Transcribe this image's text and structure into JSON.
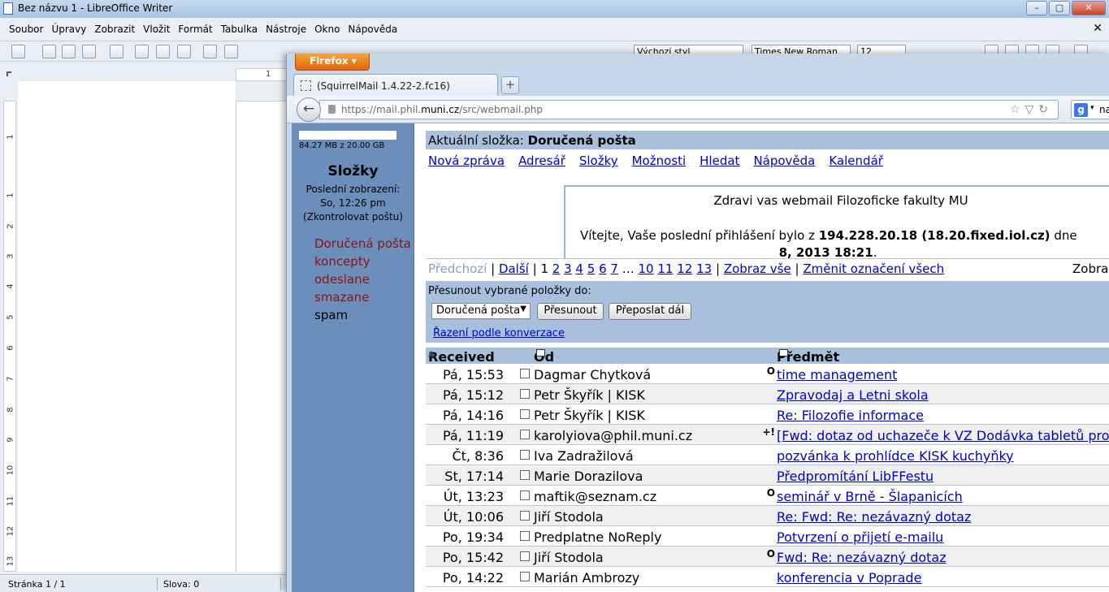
{
  "writer": {
    "title": "Bez názvu 1 - LibreOffice Writer",
    "menu": [
      "Soubor",
      "Úpravy",
      "Zobrazit",
      "Vložit",
      "Formát",
      "Tabulka",
      "Nástroje",
      "Okno",
      "Nápověda"
    ],
    "toolbar": {
      "style": "Výchozí styl",
      "font": "Times New Roman",
      "size": "12"
    },
    "ruler_top_label": "1",
    "ruler_left": [
      "1",
      "1",
      "2",
      "3",
      "4",
      "5",
      "6",
      "7",
      "8",
      "9",
      "10",
      "11",
      "12",
      "13"
    ],
    "status": {
      "page": "Stránka 1 / 1",
      "words": "Slova: 0"
    }
  },
  "firefox": {
    "button_label": "Firefox",
    "tab_label": "(SquirrelMail 1.4.22-2.fc16)",
    "newtab_label": "+",
    "url_prefix": "https://mail.phil.",
    "url_domain": "muni.cz",
    "url_path": "/src/webmail.php",
    "search_text": "na"
  },
  "sidebar": {
    "quota": "84.27 MB z 20.00 GB",
    "title": "Složky",
    "last_label": "Poslední zobrazení:",
    "last_time": "So, 12:26 pm",
    "check_open": "(",
    "check_link": "Zkontrolovat poštu",
    "check_close": ")",
    "folders": [
      "Doručená pošta",
      "koncepty",
      "odeslane",
      "smazane",
      "spam"
    ]
  },
  "main": {
    "current_label": "Aktuální složka:",
    "current_folder": "Doručená pošta",
    "nav": [
      "Nová zpráva",
      "Adresář",
      "Složky",
      "Možnosti",
      "Hledat",
      "Nápověda",
      "Kalendář"
    ],
    "motd": {
      "line1": "Zdravi vas webmail Filozoficke fakulty MU",
      "line2_pre": "Vítejte, Vaše poslední přihlášení bylo z ",
      "line2_bold": "194.228.20.18 (18.20.fixed.iol.cz)",
      "line2_post": " dne",
      "line3_bold": "8, 2013 18:21",
      "line3_post": "."
    },
    "paging": {
      "prev": "Předchozí",
      "next": "Další",
      "current": "1",
      "pages": [
        "2",
        "3",
        "4",
        "5",
        "6",
        "7"
      ],
      "ellipsis": "…",
      "pages_end": [
        "10",
        "11",
        "12",
        "13"
      ],
      "show_all": "Zobraz vše",
      "toggle_all": "Změnit označení všech",
      "right": "Zobra"
    },
    "move": {
      "label": "Přesunout vybrané položky do:",
      "target": "Doručená pošta",
      "move_btn": "Přesunout",
      "forward_btn": "Přeposlat dál",
      "thread_link": "Řazení podle konverzace"
    },
    "table": {
      "col_received": "Received",
      "col_from": "Od",
      "col_subject": "Předmět",
      "rows": [
        {
          "date": "Pá, 15:53",
          "from": "Dagmar Chytková",
          "flag": "O",
          "subject": "time management"
        },
        {
          "date": "Pá, 15:12",
          "from": "Petr Škyřík | KISK",
          "flag": "",
          "subject": "Zpravodaj a Letni skola"
        },
        {
          "date": "Pá, 14:16",
          "from": "Petr Škyřík | KISK",
          "flag": "",
          "subject": "Re: Filozofie informace"
        },
        {
          "date": "Pá, 11:19",
          "from": "karolyiova@phil.muni.cz",
          "flag": "+!",
          "subject": "[Fwd: dotaz od uchazeče k VZ Dodávka tabletů pro"
        },
        {
          "date": "Čt, 8:36",
          "from": "Iva Zadražilová",
          "flag": "",
          "subject": "pozvánka k prohlídce KISK kuchyňky"
        },
        {
          "date": "St, 17:14",
          "from": "Marie Dorazilova",
          "flag": "",
          "subject": "Předpromítání LibFFestu"
        },
        {
          "date": "Út, 13:23",
          "from": "maftik@seznam.cz",
          "flag": "O",
          "subject": "seminář v Brně - Šlapanicích"
        },
        {
          "date": "Út, 10:06",
          "from": "Jiří Stodola",
          "flag": "",
          "subject": "Re: Fwd: Re: nezávazný dotaz"
        },
        {
          "date": "Po, 19:34",
          "from": "Predplatne NoReply",
          "flag": "",
          "subject": "Potvrzení o přijetí e-mailu"
        },
        {
          "date": "Po, 15:42",
          "from": "Jiří Stodola",
          "flag": "O",
          "subject": "Fwd: Re: nezávazný dotaz"
        },
        {
          "date": "Po, 14:22",
          "from": "Marián Ambrozy",
          "flag": "",
          "subject": "konferencia v Poprade"
        }
      ]
    }
  }
}
